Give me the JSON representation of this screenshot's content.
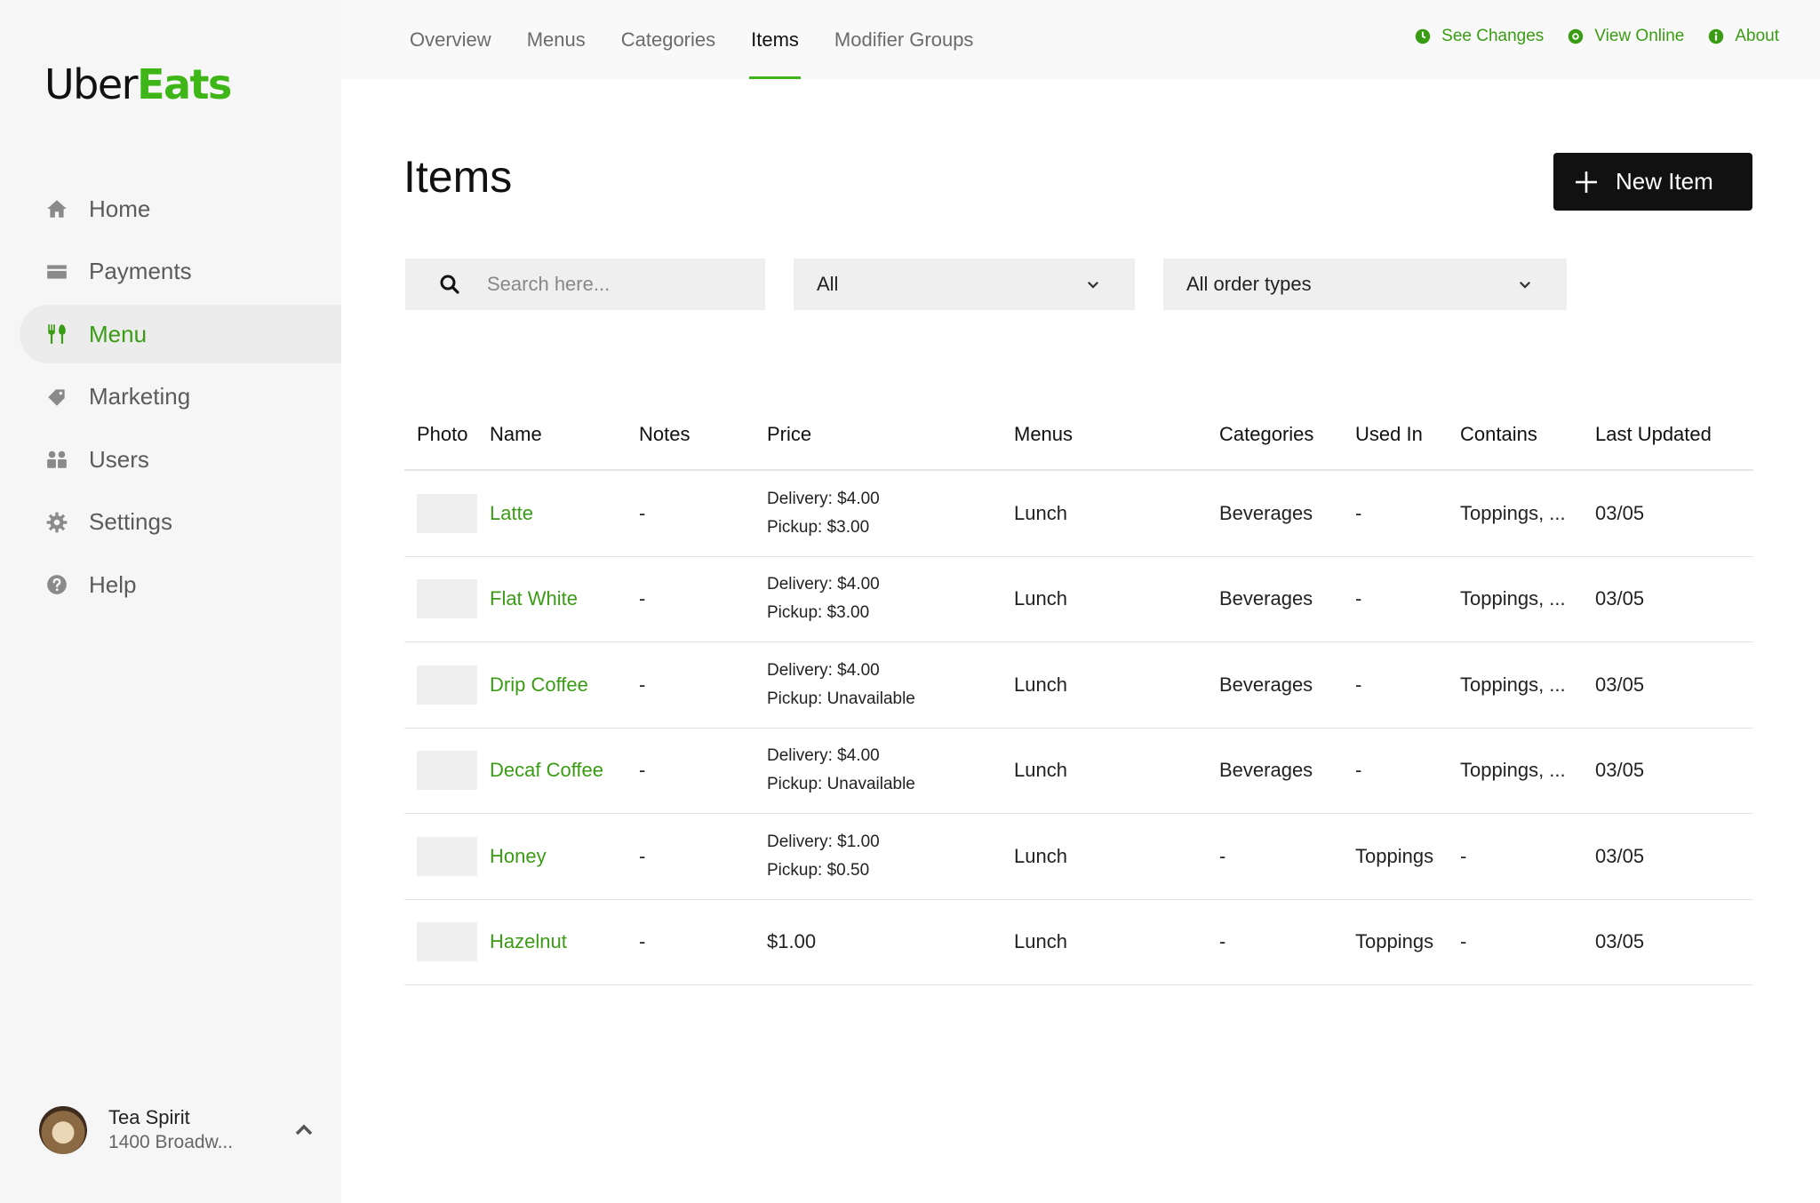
{
  "brand": {
    "uber": "Uber",
    "eats": "Eats"
  },
  "sidebar": {
    "items": [
      {
        "label": "Home",
        "icon": "home-icon"
      },
      {
        "label": "Payments",
        "icon": "payments-icon"
      },
      {
        "label": "Menu",
        "icon": "menu-icon",
        "active": true
      },
      {
        "label": "Marketing",
        "icon": "tag-icon"
      },
      {
        "label": "Users",
        "icon": "users-icon"
      },
      {
        "label": "Settings",
        "icon": "gear-icon"
      },
      {
        "label": "Help",
        "icon": "help-icon"
      }
    ],
    "account": {
      "name": "Tea Spirit",
      "address": "1400 Broadw..."
    }
  },
  "topnav": {
    "tabs": [
      {
        "label": "Overview"
      },
      {
        "label": "Menus"
      },
      {
        "label": "Categories"
      },
      {
        "label": "Items",
        "active": true
      },
      {
        "label": "Modifier Groups"
      }
    ],
    "links": [
      {
        "label": "See Changes",
        "icon": "clock-icon"
      },
      {
        "label": "View Online",
        "icon": "eye-icon"
      },
      {
        "label": "About",
        "icon": "info-icon"
      }
    ]
  },
  "page": {
    "title": "Items",
    "new_button": "New Item"
  },
  "filters": {
    "search_placeholder": "Search here...",
    "menu_select": "All",
    "order_type_select": "All order types"
  },
  "table": {
    "headers": [
      "Photo",
      "Name",
      "Notes",
      "Price",
      "Menus",
      "Categories",
      "Used In",
      "Contains",
      "Last Updated"
    ],
    "rows": [
      {
        "name": "Latte",
        "notes": "-",
        "price": [
          "Delivery: $4.00",
          "Pickup: $3.00"
        ],
        "menus": "Lunch",
        "categories": "Beverages",
        "used_in": "-",
        "contains": "Toppings, ...",
        "updated": "03/05"
      },
      {
        "name": "Flat White",
        "notes": "-",
        "price": [
          "Delivery: $4.00",
          "Pickup: $3.00"
        ],
        "menus": "Lunch",
        "categories": "Beverages",
        "used_in": "-",
        "contains": "Toppings, ...",
        "updated": "03/05"
      },
      {
        "name": "Drip Coffee",
        "notes": "-",
        "price": [
          "Delivery: $4.00",
          "Pickup: Unavailable"
        ],
        "menus": "Lunch",
        "categories": "Beverages",
        "used_in": "-",
        "contains": "Toppings, ...",
        "updated": "03/05"
      },
      {
        "name": "Decaf Coffee",
        "notes": "-",
        "price": [
          "Delivery: $4.00",
          "Pickup: Unavailable"
        ],
        "menus": "Lunch",
        "categories": "Beverages",
        "used_in": "-",
        "contains": "Toppings, ...",
        "updated": "03/05"
      },
      {
        "name": "Honey",
        "notes": "-",
        "price": [
          "Delivery: $1.00",
          "Pickup: $0.50"
        ],
        "menus": "Lunch",
        "categories": "-",
        "used_in": "Toppings",
        "contains": "-",
        "updated": "03/05"
      },
      {
        "name": "Hazelnut",
        "notes": "-",
        "price": [
          "$1.00"
        ],
        "menus": "Lunch",
        "categories": "-",
        "used_in": "Toppings",
        "contains": "-",
        "updated": "03/05"
      }
    ]
  },
  "colors": {
    "accent": "#3fb618",
    "accent_text": "#3a9c14",
    "button_bg": "#111111"
  }
}
